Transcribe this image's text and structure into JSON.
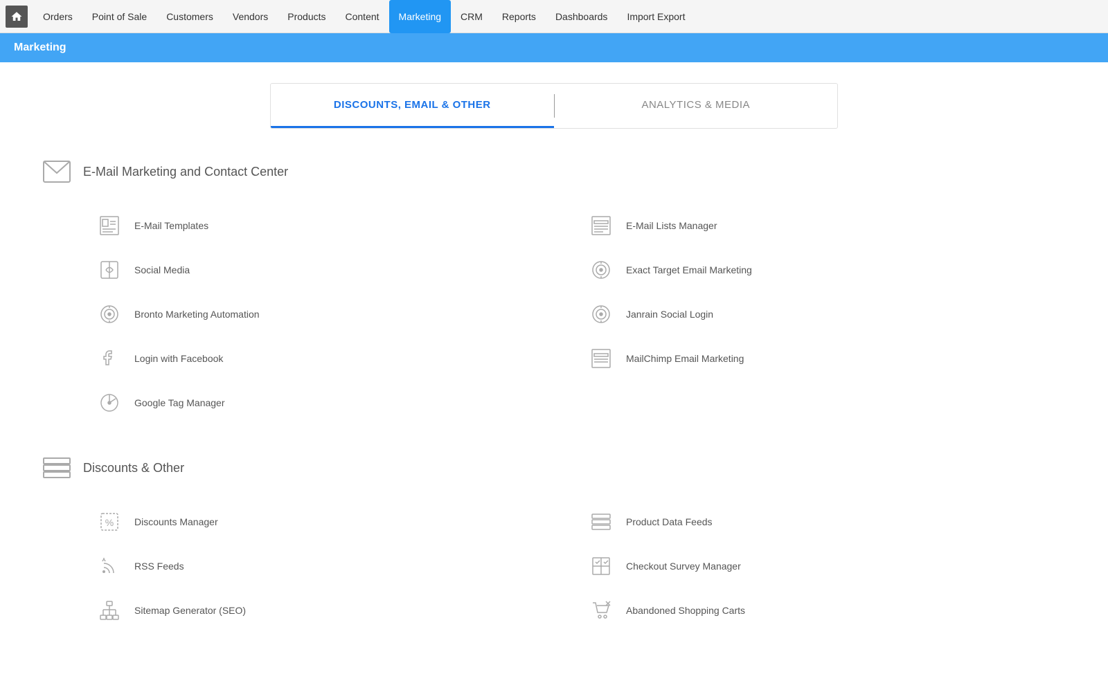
{
  "nav": {
    "items": [
      {
        "label": "Orders",
        "active": false
      },
      {
        "label": "Point of Sale",
        "active": false
      },
      {
        "label": "Customers",
        "active": false
      },
      {
        "label": "Vendors",
        "active": false
      },
      {
        "label": "Products",
        "active": false
      },
      {
        "label": "Content",
        "active": false
      },
      {
        "label": "Marketing",
        "active": true
      },
      {
        "label": "CRM",
        "active": false
      },
      {
        "label": "Reports",
        "active": false
      },
      {
        "label": "Dashboards",
        "active": false
      },
      {
        "label": "Import Export",
        "active": false
      }
    ]
  },
  "page_header": "Marketing",
  "tabs": [
    {
      "label": "DISCOUNTS, EMAIL & OTHER",
      "active": true
    },
    {
      "label": "ANALYTICS & MEDIA",
      "active": false
    }
  ],
  "sections": [
    {
      "title": "E-Mail Marketing and Contact Center",
      "icon": "email-icon",
      "items": [
        {
          "label": "E-Mail Templates",
          "icon": "email-template-icon",
          "col": 1
        },
        {
          "label": "E-Mail Lists Manager",
          "icon": "email-list-icon",
          "col": 2
        },
        {
          "label": "Social Media",
          "icon": "social-media-icon",
          "col": 1
        },
        {
          "label": "Exact Target Email Marketing",
          "icon": "target-icon",
          "col": 2
        },
        {
          "label": "Bronto Marketing Automation",
          "icon": "bronto-icon",
          "col": 1
        },
        {
          "label": "Janrain Social Login",
          "icon": "janrain-icon",
          "col": 2
        },
        {
          "label": "Login with Facebook",
          "icon": "facebook-icon",
          "col": 1
        },
        {
          "label": "MailChimp Email Marketing",
          "icon": "mailchimp-icon",
          "col": 2
        },
        {
          "label": "Google Tag Manager",
          "icon": "google-tag-icon",
          "col": 1
        }
      ]
    },
    {
      "title": "Discounts & Other",
      "icon": "discounts-icon",
      "items": [
        {
          "label": "Discounts Manager",
          "icon": "discount-icon",
          "col": 1
        },
        {
          "label": "Product Data Feeds",
          "icon": "data-feeds-icon",
          "col": 2
        },
        {
          "label": "RSS Feeds",
          "icon": "rss-icon",
          "col": 1
        },
        {
          "label": "Checkout Survey Manager",
          "icon": "survey-icon",
          "col": 2
        },
        {
          "label": "Sitemap Generator (SEO)",
          "icon": "sitemap-icon",
          "col": 1
        },
        {
          "label": "Abandoned Shopping Carts",
          "icon": "cart-icon",
          "col": 2
        }
      ]
    }
  ]
}
